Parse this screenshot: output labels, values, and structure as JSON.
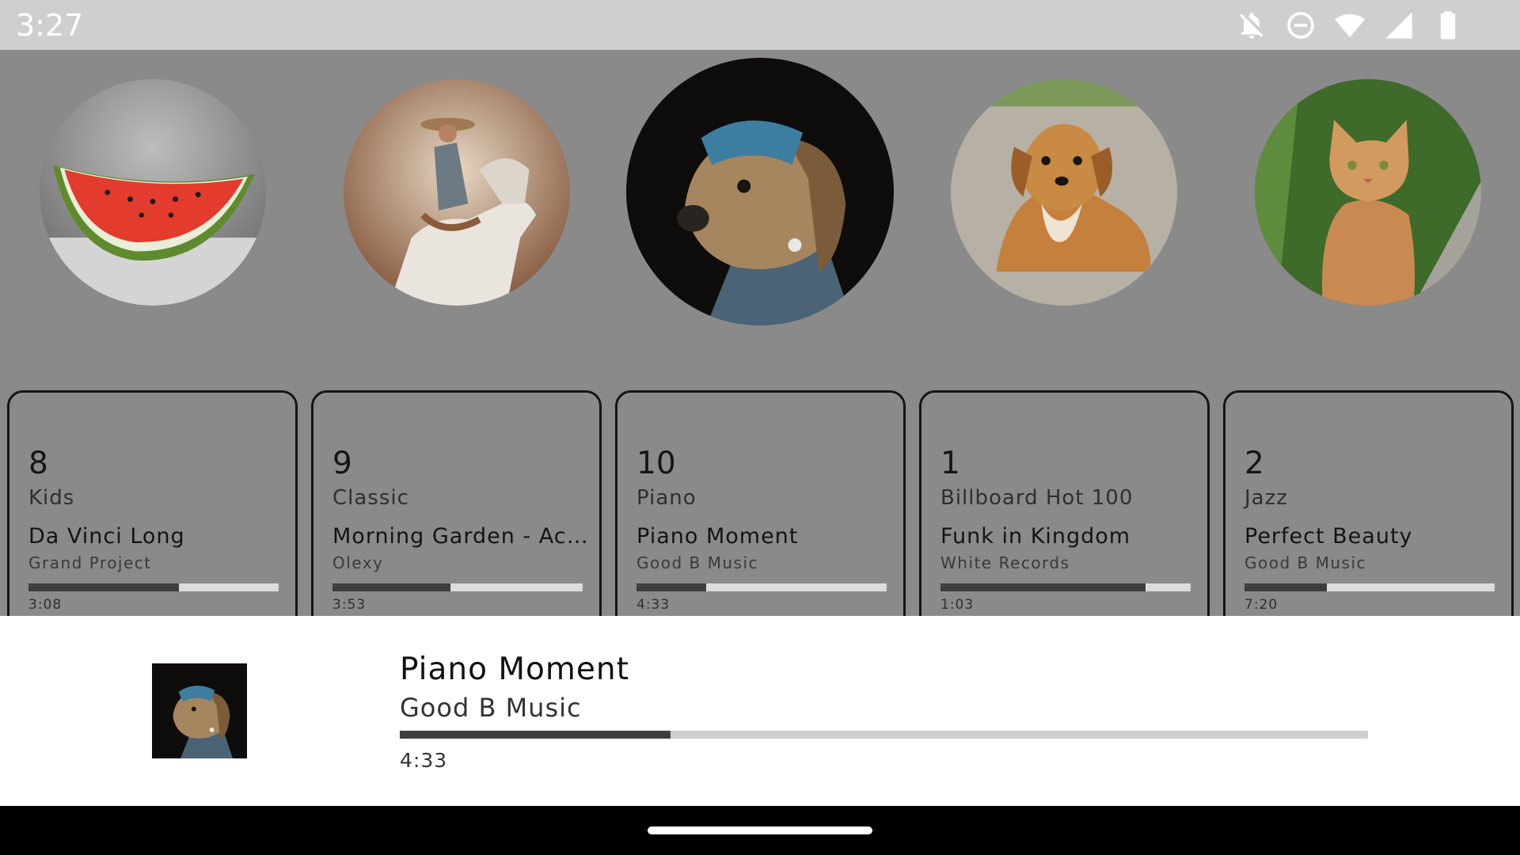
{
  "status_bar": {
    "time": "3:27",
    "icons": [
      "notifications-off-icon",
      "do-not-disturb-icon",
      "wifi-icon",
      "signal-icon",
      "battery-icon"
    ]
  },
  "colors": {
    "background": "#8a8a8a",
    "progress_fill": "#3e3e3e",
    "progress_track": "#dcdcdc",
    "card_border": "#161616"
  },
  "carousel": {
    "items": [
      {
        "number": "8",
        "genre": "Kids",
        "title": "Da Vinci Long",
        "artist": "Grand Project",
        "duration": "3:08",
        "progress": 0.6,
        "artwork": "watermelon-artwork"
      },
      {
        "number": "9",
        "genre": "Classic",
        "title": "Morning Garden - Acou…",
        "artist": "Olexy",
        "duration": "3:53",
        "progress": 0.47,
        "artwork": "cowboy-horse-artwork"
      },
      {
        "number": "10",
        "genre": "Piano",
        "title": "Piano Moment",
        "artist": "Good B Music",
        "duration": "4:33",
        "progress": 0.28,
        "artwork": "dog-pearl-earring-artwork"
      },
      {
        "number": "1",
        "genre": "Billboard Hot 100",
        "title": "Funk in Kingdom",
        "artist": "White Records",
        "duration": "1:03",
        "progress": 0.82,
        "artwork": "dog-artwork"
      },
      {
        "number": "2",
        "genre": "Jazz",
        "title": "Perfect Beauty",
        "artist": "Good B Music",
        "duration": "7:20",
        "progress": 0.33,
        "artwork": "cat-artwork"
      }
    ]
  },
  "now_playing": {
    "title": "Piano Moment",
    "artist": "Good B Music",
    "duration": "4:33",
    "progress": 0.28,
    "artwork": "dog-pearl-earring-artwork"
  }
}
